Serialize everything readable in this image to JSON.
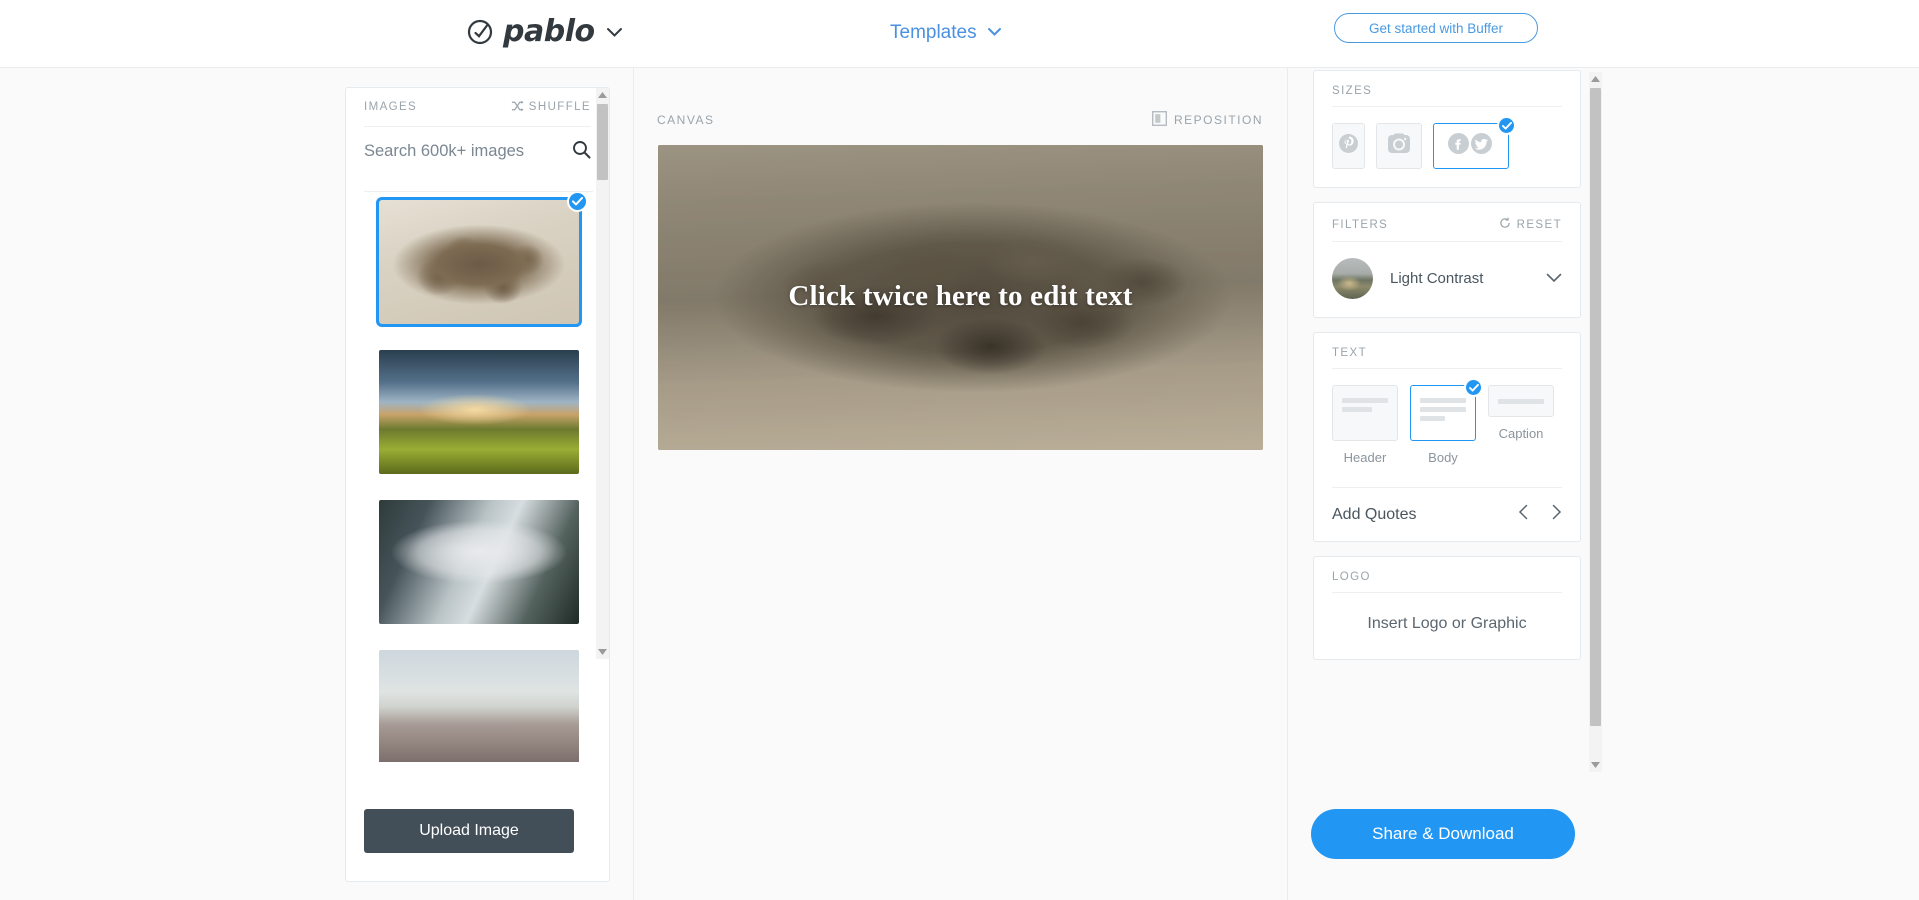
{
  "header": {
    "logo_text": "pablo",
    "logo_icon": "pablo-circle-check-icon",
    "logo_caret_icon": "chevron-down-icon",
    "templates_label": "Templates",
    "templates_caret_icon": "chevron-down-icon",
    "buffer_button": "Get started with Buffer",
    "accent_blue": "#4a9ae2"
  },
  "images_panel": {
    "title": "IMAGES",
    "shuffle_label": "SHUFFLE",
    "shuffle_icon": "shuffle-icon",
    "search_placeholder": "Search 600k+ images",
    "search_value": "",
    "search_icon": "search-icon",
    "upload_button": "Upload Image",
    "upload_button_color": "#424e58",
    "scroll_up_icon": "triangle-up-icon",
    "scroll_down_icon": "triangle-down-icon",
    "thumbnails": [
      {
        "name": "coffee-beans",
        "selected": true,
        "check_icon": "check-icon"
      },
      {
        "name": "forest-sunset",
        "selected": false,
        "check_icon": ""
      },
      {
        "name": "foggy-valley",
        "selected": false,
        "check_icon": ""
      },
      {
        "name": "city-skyline",
        "selected": false,
        "check_icon": ""
      }
    ]
  },
  "canvas": {
    "title": "CANVAS",
    "reposition_label": "REPOSITION",
    "reposition_icon": "reposition-icon",
    "text": "Click twice here to edit text",
    "image_name": "coffee-beans"
  },
  "sizes": {
    "title": "SIZES",
    "options": [
      {
        "name": "pinterest",
        "icon": "pinterest-icon",
        "selected": false
      },
      {
        "name": "instagram",
        "icon": "instagram-icon",
        "selected": false
      },
      {
        "name": "facebook-twitter",
        "icon": "facebook-twitter-icon",
        "selected": true,
        "check_icon": "check-icon"
      }
    ]
  },
  "filters": {
    "title": "FILTERS",
    "reset_label": "RESET",
    "reset_icon": "reset-circle-icon",
    "selected_filter": "Light Contrast",
    "chevron_icon": "chevron-down-icon",
    "thumb_name": "landscape-filter-preview"
  },
  "text_panel": {
    "title": "TEXT",
    "options": [
      {
        "label": "Header",
        "selected": false
      },
      {
        "label": "Body",
        "selected": true,
        "check_icon": "check-icon"
      },
      {
        "label": "Caption",
        "selected": false
      }
    ],
    "quotes_label": "Add Quotes",
    "prev_icon": "chevron-left-icon",
    "next_icon": "chevron-right-icon"
  },
  "logo_panel": {
    "title": "LOGO",
    "insert_label": "Insert Logo or Graphic"
  },
  "share": {
    "label": "Share & Download",
    "color": "#2196f3"
  }
}
